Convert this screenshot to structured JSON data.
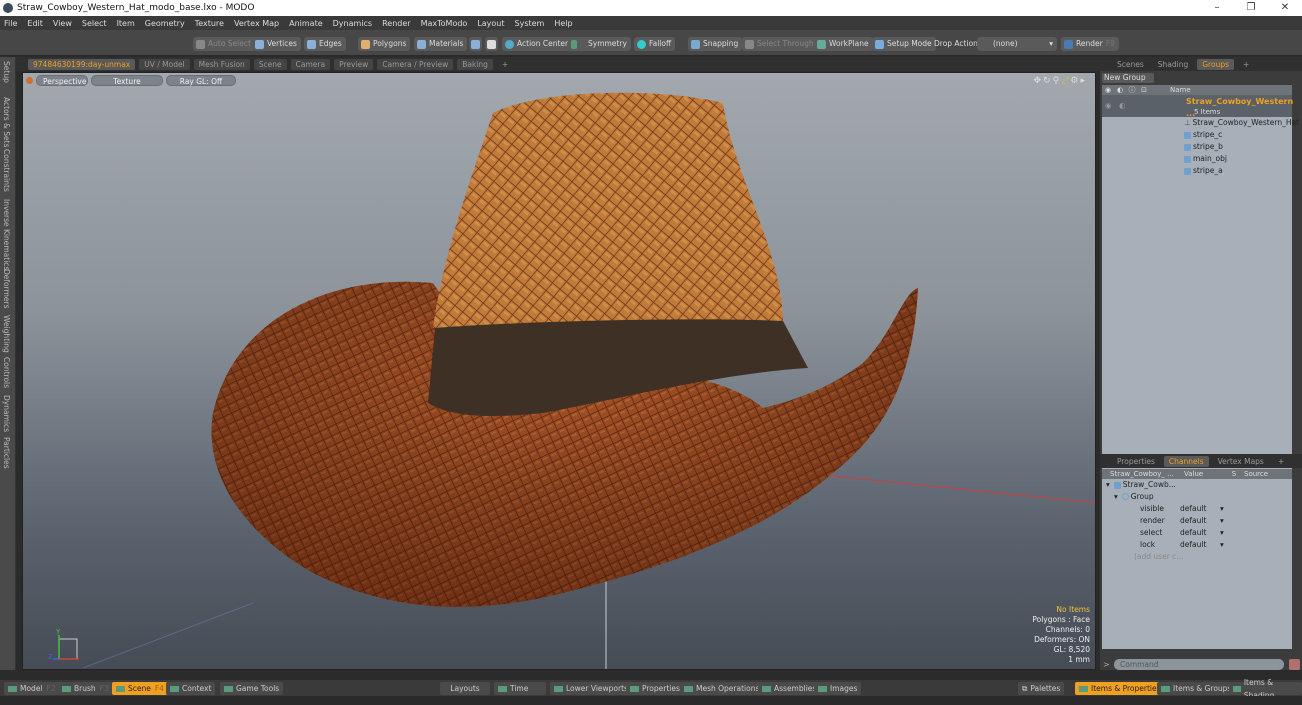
{
  "window": {
    "title": "Straw_Cowboy_Western_Hat_modo_base.lxo - MODO",
    "controls": [
      "–",
      "❐",
      "✕"
    ]
  },
  "menu": [
    "File",
    "Edit",
    "View",
    "Select",
    "Item",
    "Geometry",
    "Texture",
    "Vertex Map",
    "Animate",
    "Dynamics",
    "Render",
    "MaxToModo",
    "Layout",
    "System",
    "Help"
  ],
  "toolbar": {
    "auto_select": "Auto Select",
    "vertices": "Vertices",
    "edges": "Edges",
    "polygons": "Polygons",
    "materials": "Materials",
    "action_center": "Action Center",
    "symmetry": "Symmetry",
    "falloff": "Falloff",
    "snapping": "Snapping",
    "select_through": "Select Through",
    "workplane": "WorkPlane",
    "setup_mode": "Setup Mode",
    "drop_action_label": "Drop Action",
    "drop_action_value": "(none)",
    "render": "Render",
    "render_key": "F9"
  },
  "left_tabs": [
    "Setup",
    "Actors & Sets",
    "Constraints",
    "Inverse Kinematics",
    "Deformers",
    "Weighting",
    "Controls",
    "Dynamics",
    "Particles"
  ],
  "viewport_tabs": [
    "97484630199:day-unmax",
    "UV / Model",
    "Mesh Fusion",
    "Scene",
    "Camera",
    "Preview",
    "Camera / Preview",
    "Baking",
    "+"
  ],
  "viewport": {
    "view": "Perspective",
    "shading": "Texture",
    "raygl": "Ray GL: Off",
    "hud": {
      "items": "No Items",
      "polygons": "Polygons : Face",
      "channels": "Channels: 0",
      "deformers": "Deformers: ON",
      "gl": "GL: 8,520",
      "unit": "1 mm"
    },
    "axis_labels": {
      "y": "Y",
      "z": "Z"
    }
  },
  "right_tabs": [
    "Scenes",
    "Shading",
    "Groups",
    "+"
  ],
  "groups": {
    "new_group": "New Group",
    "name_header": "Name",
    "group_name": "Straw_Cowboy_Western ...",
    "group_count": "5 Items",
    "children": [
      "Straw_Cowboy_Western_Hat",
      "stripe_c",
      "stripe_b",
      "main_obj",
      "stripe_a"
    ]
  },
  "channel_tabs": [
    "Properties",
    "Channels",
    "Vertex Maps",
    "+"
  ],
  "channels": {
    "headers": [
      "Straw_Cowboy_ ...",
      "Value",
      "S",
      "Source"
    ],
    "root": "Straw_Cowb...",
    "group": "Group",
    "rows": [
      {
        "name": "visible",
        "value": "default"
      },
      {
        "name": "render",
        "value": "default"
      },
      {
        "name": "select",
        "value": "default"
      },
      {
        "name": "lock",
        "value": "default"
      }
    ],
    "add_user": "(add user c..."
  },
  "command_placeholder": "Command",
  "bottom_left": [
    {
      "label": "Model",
      "key": "F2"
    },
    {
      "label": "Brush",
      "key": "F3"
    },
    {
      "label": "Scene",
      "key": "F4",
      "active": true
    },
    {
      "label": "Context",
      "key": ""
    },
    {
      "label": "Game Tools",
      "key": ""
    }
  ],
  "bottom_mid": [
    "Layouts",
    "Time",
    "Lower Viewports",
    "Properties",
    "Mesh Operations",
    "Assemblies",
    "Images"
  ],
  "bottom_right": [
    {
      "label": "Palettes"
    },
    {
      "label": "Items & Properties",
      "active": true
    },
    {
      "label": "Items & Groups"
    },
    {
      "label": "Items & Shading"
    }
  ],
  "colors": {
    "accent": "#f0a020",
    "hat": "#b0582a",
    "band": "#3e3024"
  }
}
